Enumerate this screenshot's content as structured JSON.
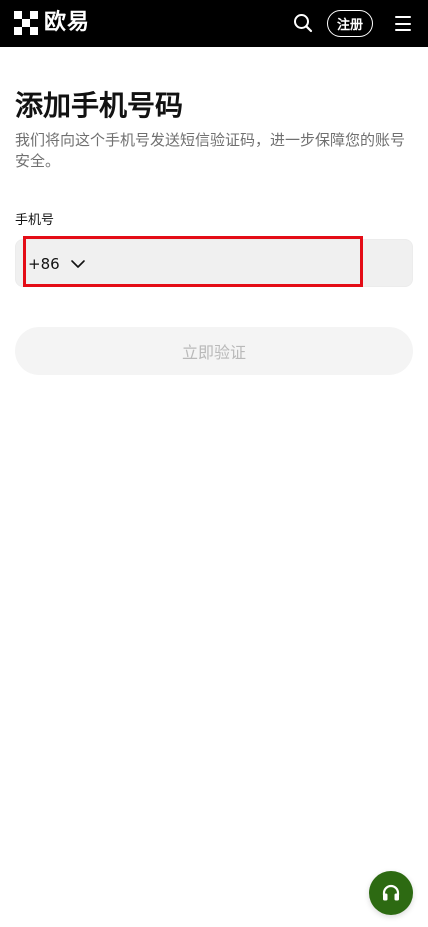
{
  "header": {
    "logo_text": "欧易",
    "register_label": "注册"
  },
  "page": {
    "title": "添加手机号码",
    "description": "我们将向这个手机号发送短信验证码，进一步保障您的账号安全。"
  },
  "form": {
    "phone_label": "手机号",
    "country_code": "+86",
    "verify_button": "立即验证"
  },
  "icons": {
    "search": "search-icon",
    "menu": "hamburger-icon",
    "dropdown": "chevron-down-icon",
    "support": "headset-icon"
  },
  "colors": {
    "header_bg": "#000000",
    "highlight": "#e40c16",
    "support_bg": "#2d6a12",
    "disabled_button_bg": "#f4f4f4",
    "disabled_button_text": "#b9b9b9"
  }
}
